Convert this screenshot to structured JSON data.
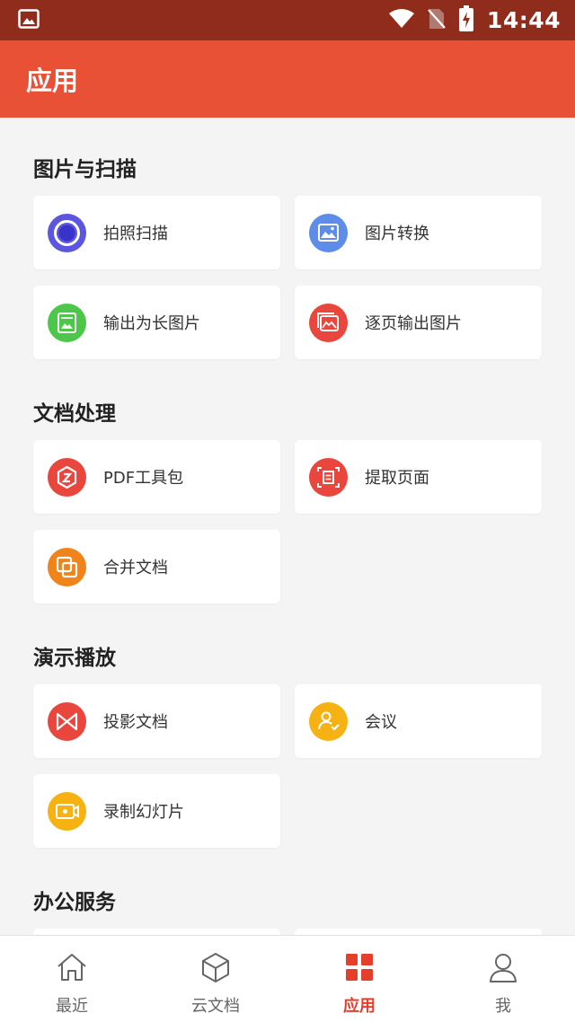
{
  "status_bar": {
    "time": "14:44",
    "icons": [
      "image-icon",
      "wifi-icon",
      "no-sim-icon",
      "battery-charging-icon"
    ]
  },
  "header": {
    "title": "应用"
  },
  "sections": [
    {
      "title": "图片与扫描",
      "items": [
        {
          "label": "拍照扫描",
          "icon": "camera-scan-icon",
          "color": "#5b55e0"
        },
        {
          "label": "图片转换",
          "icon": "image-convert-icon",
          "color": "#5d8de8"
        },
        {
          "label": "输出为长图片",
          "icon": "long-image-icon",
          "color": "#4cc74a"
        },
        {
          "label": "逐页输出图片",
          "icon": "page-image-icon",
          "color": "#e9463d"
        }
      ]
    },
    {
      "title": "文档处理",
      "items": [
        {
          "label": "PDF工具包",
          "icon": "pdf-toolkit-icon",
          "color": "#e9463d"
        },
        {
          "label": "提取页面",
          "icon": "extract-page-icon",
          "color": "#e9463d"
        },
        {
          "label": "合并文档",
          "icon": "merge-document-icon",
          "color": "#f08319"
        }
      ]
    },
    {
      "title": "演示播放",
      "items": [
        {
          "label": "投影文档",
          "icon": "projection-icon",
          "color": "#e9463d"
        },
        {
          "label": "会议",
          "icon": "meeting-icon",
          "color": "#f5b212"
        },
        {
          "label": "录制幻灯片",
          "icon": "record-slides-icon",
          "color": "#f5b212"
        }
      ]
    },
    {
      "title": "办公服务",
      "items": []
    }
  ],
  "bottom_nav": {
    "items": [
      {
        "label": "最近",
        "icon": "home-icon",
        "active": false
      },
      {
        "label": "云文档",
        "icon": "cube-icon",
        "active": false
      },
      {
        "label": "应用",
        "icon": "apps-grid-icon",
        "active": true
      },
      {
        "label": "我",
        "icon": "person-icon",
        "active": false
      }
    ],
    "active_color": "#e53f2c"
  },
  "colors": {
    "status_bar": "#8f2c1c",
    "header": "#e95136",
    "background": "#f4f4f4"
  }
}
